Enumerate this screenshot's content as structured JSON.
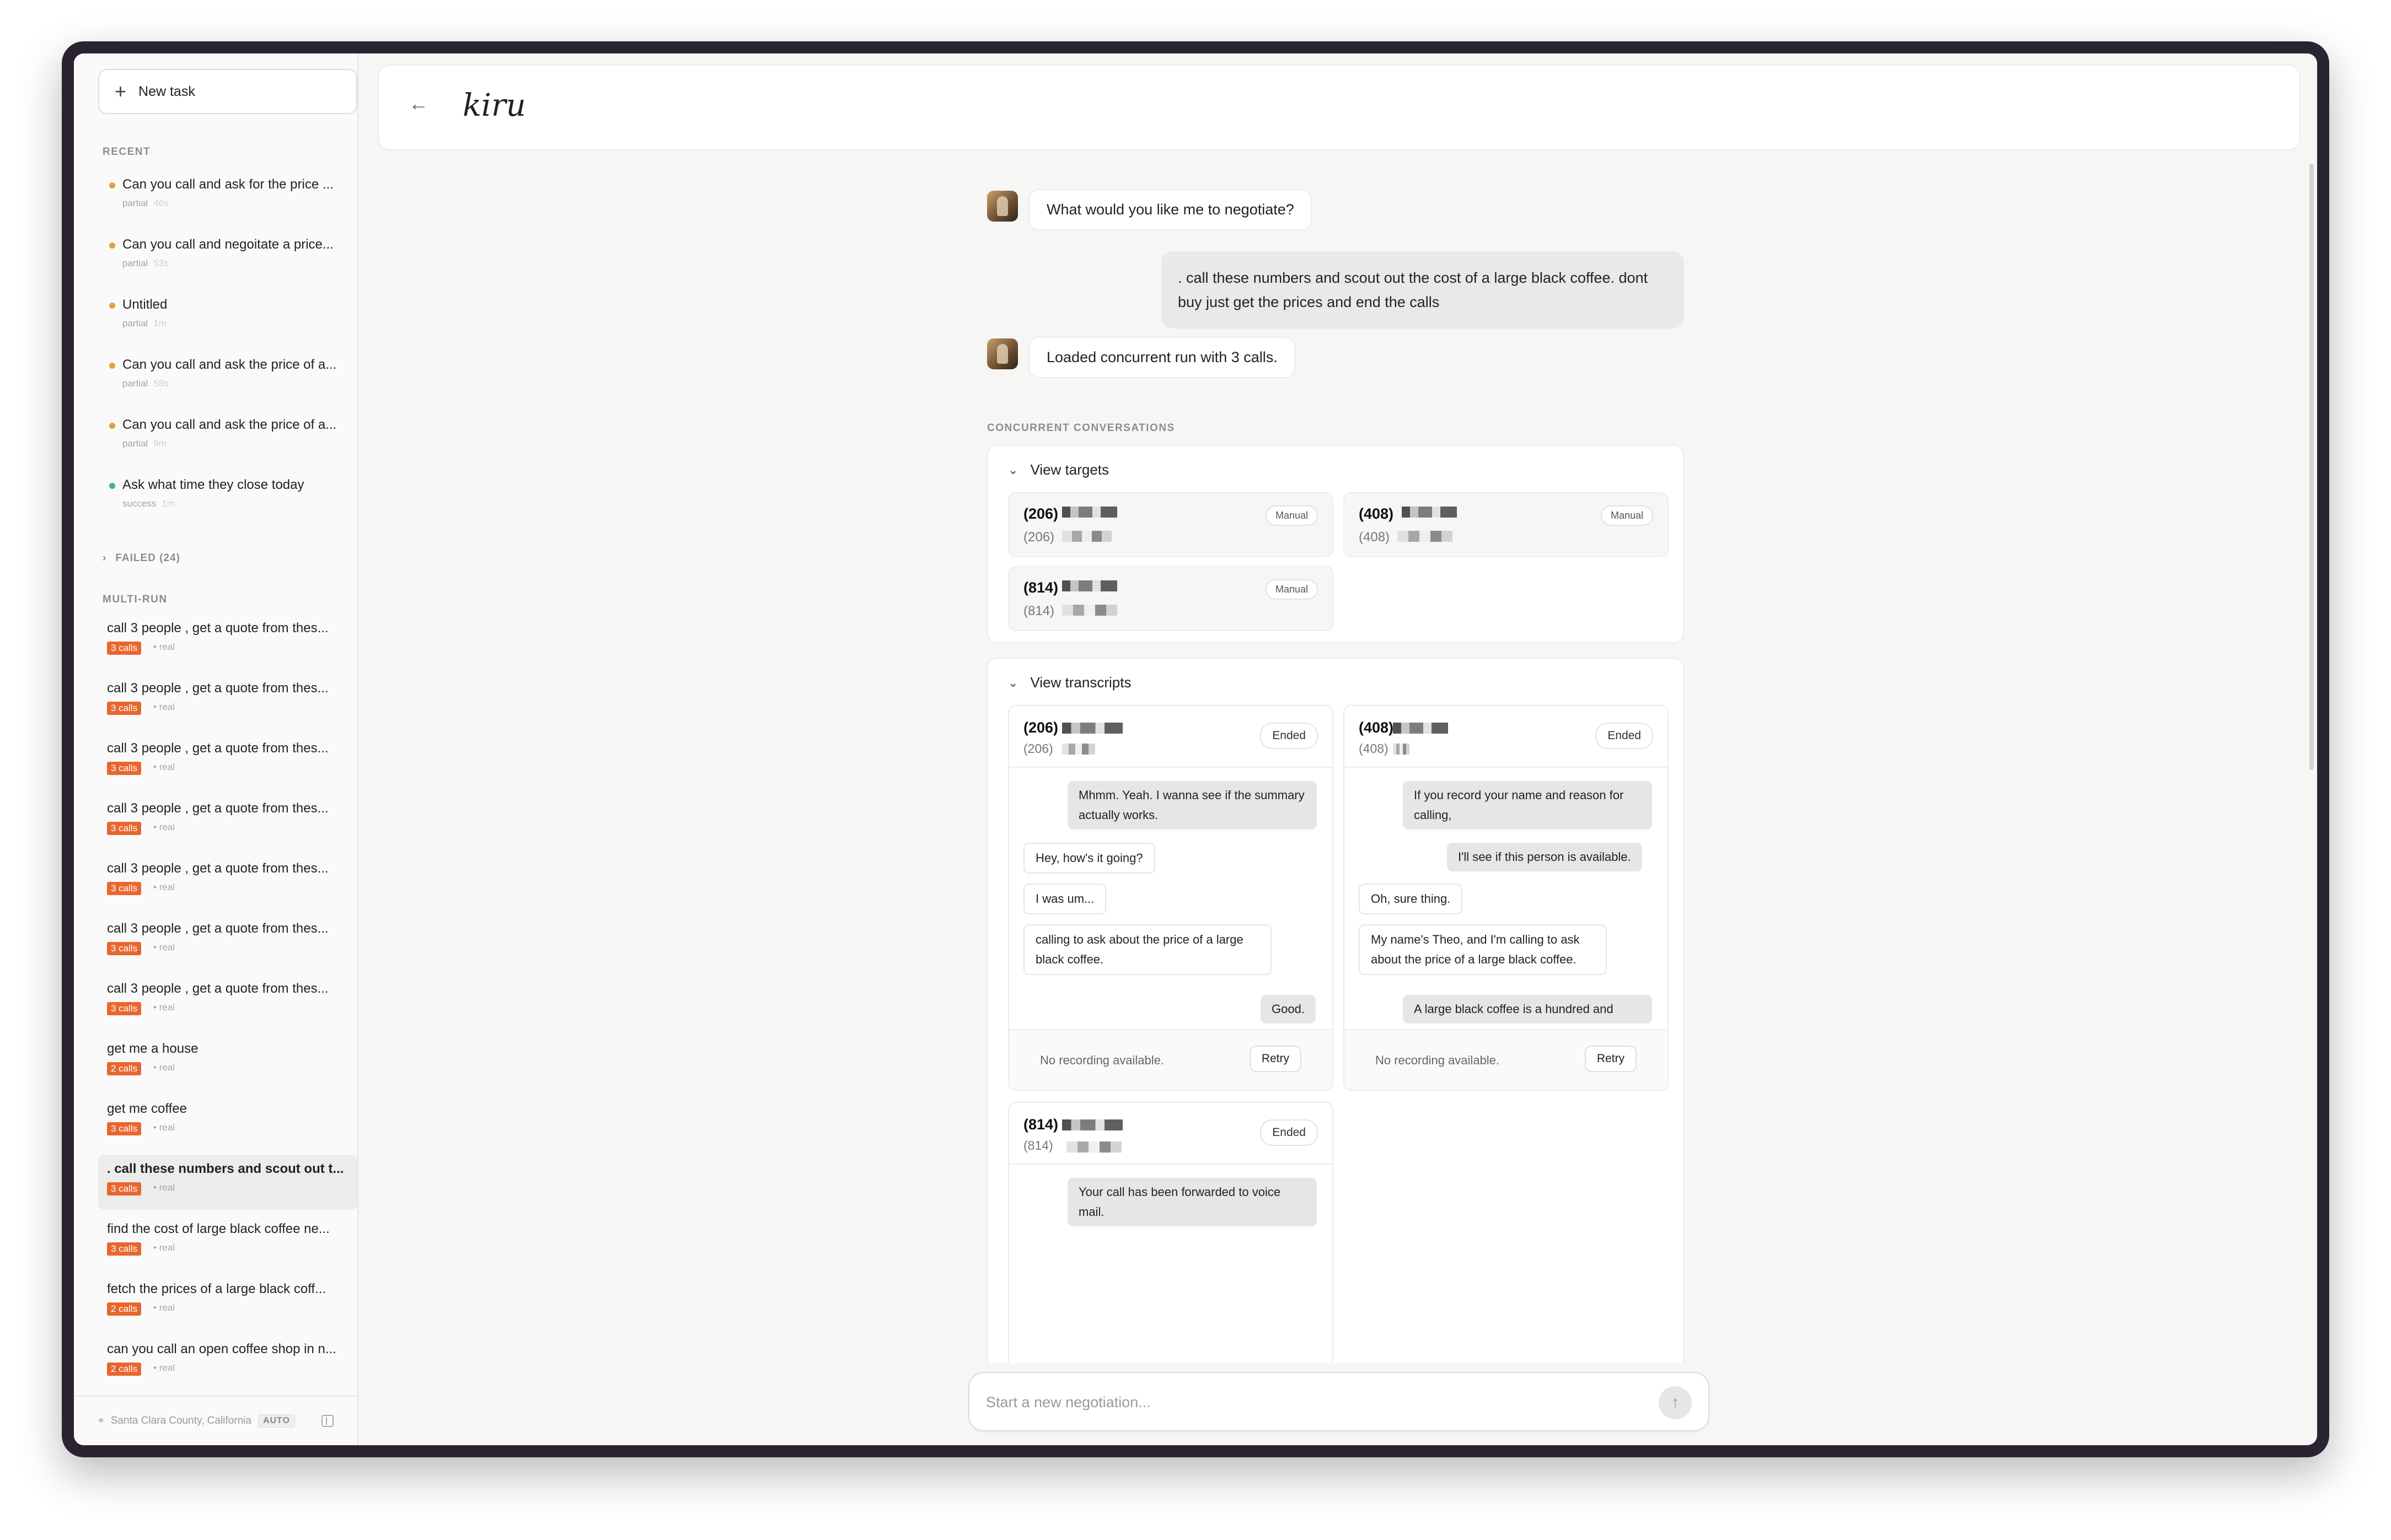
{
  "sidebar": {
    "new_task_label": "New task",
    "recent_label": "RECENT",
    "recent": [
      {
        "title": "Can you call and ask for the price ...",
        "status": "partial",
        "time": "46s",
        "color": "#e0a23a"
      },
      {
        "title": "Can you call and negoitate a price...",
        "status": "partial",
        "time": "53s",
        "color": "#e0a23a"
      },
      {
        "title": "Untitled",
        "status": "partial",
        "time": "1m",
        "color": "#e0a23a"
      },
      {
        "title": "Can you call and ask the price of a...",
        "status": "partial",
        "time": "58s",
        "color": "#e0a23a"
      },
      {
        "title": "Can you call and ask the price of a...",
        "status": "partial",
        "time": "9m",
        "color": "#e0a23a"
      },
      {
        "title": "Ask what time they close today",
        "status": "success",
        "time": "1m",
        "color": "#3fb47b"
      }
    ],
    "failed_label": "FAILED (24)",
    "multirun_label": "MULTI-RUN",
    "multirun": [
      {
        "title": "call 3 people , get a quote from thes...",
        "calls": "3 calls",
        "mode": "real"
      },
      {
        "title": "call 3 people , get a quote from thes...",
        "calls": "3 calls",
        "mode": "real"
      },
      {
        "title": "call 3 people , get a quote from thes...",
        "calls": "3 calls",
        "mode": "real"
      },
      {
        "title": "call 3 people , get a quote from thes...",
        "calls": "3 calls",
        "mode": "real"
      },
      {
        "title": "call 3 people , get a quote from thes...",
        "calls": "3 calls",
        "mode": "real"
      },
      {
        "title": "call 3 people , get a quote from thes...",
        "calls": "3 calls",
        "mode": "real"
      },
      {
        "title": "call 3 people , get a quote from thes...",
        "calls": "3 calls",
        "mode": "real"
      },
      {
        "title": "get me a house",
        "calls": "2 calls",
        "mode": "real"
      },
      {
        "title": "get me coffee",
        "calls": "3 calls",
        "mode": "real"
      },
      {
        "title": ". call these numbers and scout out t...",
        "calls": "3 calls",
        "mode": "real"
      },
      {
        "title": "find the cost of large black coffee ne...",
        "calls": "3 calls",
        "mode": "real"
      },
      {
        "title": "fetch the prices of a large black coff...",
        "calls": "2 calls",
        "mode": "real"
      },
      {
        "title": "can you call an open coffee shop in n...",
        "calls": "2 calls",
        "mode": "real"
      }
    ],
    "location": "Santa Clara County, California",
    "auto_label": "AUTO"
  },
  "header": {
    "logo": "kiru"
  },
  "chat": {
    "bot_question": "What would you like me to negotiate?",
    "user_message": ". call these numbers and scout out the cost of a large black coffee. dont buy just get the prices and end the calls",
    "bot_loaded": "Loaded concurrent run with 3 calls.",
    "concurrent_label": "CONCURRENT CONVERSATIONS"
  },
  "targets": {
    "heading": "View targets",
    "items": [
      {
        "number": "(206)",
        "sub": "(206)",
        "tag": "Manual"
      },
      {
        "number": "(408)",
        "sub": "(408)",
        "tag": "Manual"
      },
      {
        "number": "(814)",
        "sub": "(814)",
        "tag": "Manual"
      }
    ]
  },
  "transcripts": {
    "heading": "View transcripts",
    "status_label": "Ended",
    "no_recording": "No recording available.",
    "retry_label": "Retry",
    "cards": [
      {
        "number": "(206)",
        "sub": "(206)",
        "messages": [
          "Mhmm. Yeah. I wanna see if the summary actually works.",
          "Hey, how's it going?",
          "I was um...",
          "calling to ask about the price of a large black coffee.",
          "Good."
        ]
      },
      {
        "number": "(408)",
        "sub": "(408)",
        "messages": [
          "If you record your name and reason for calling,",
          "I'll see if this person is available.",
          "Oh, sure thing.",
          "My name's Theo, and I'm calling to ask about the price of a large black coffee.",
          "A large black coffee is a hundred and"
        ]
      },
      {
        "number": "(814)",
        "sub": "(814)",
        "messages": [
          "Your call has been forwarded to voice mail."
        ]
      }
    ]
  },
  "composer": {
    "placeholder": "Start a new negotiation..."
  },
  "colors": {
    "accent": "#e9662f",
    "partial": "#e0a23a",
    "success": "#3fb47b"
  }
}
